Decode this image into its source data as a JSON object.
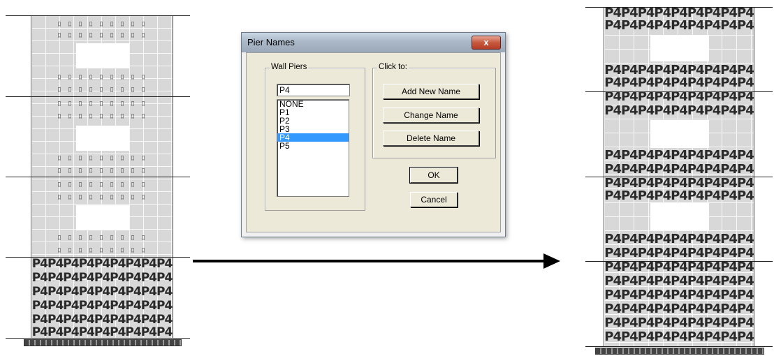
{
  "dialog": {
    "title": "Pier Names",
    "close_label": "x",
    "wall_piers_label": "Wall Piers",
    "name_value": "P4",
    "pier_list": [
      "NONE",
      "P1",
      "P2",
      "P3",
      "P4",
      "P5"
    ],
    "selected_pier": "P4",
    "click_to_label": "Click to:",
    "add_new_name_label": "Add New Name",
    "change_name_label": "Change Name",
    "delete_name_label": "Delete Name",
    "ok_label": "OK",
    "cancel_label": "Cancel"
  },
  "left_elevation": {
    "pier_label_row": "P4P4P4P4P4P4P4P4P4",
    "unassigned_mark_row": "ﾛ ﾛ ﾛ ﾛ ﾛ ﾛ ﾛ ﾛ ﾛ"
  },
  "right_elevation": {
    "pier_label_row": "P4P4P4P4P4P4P4P4P4"
  }
}
